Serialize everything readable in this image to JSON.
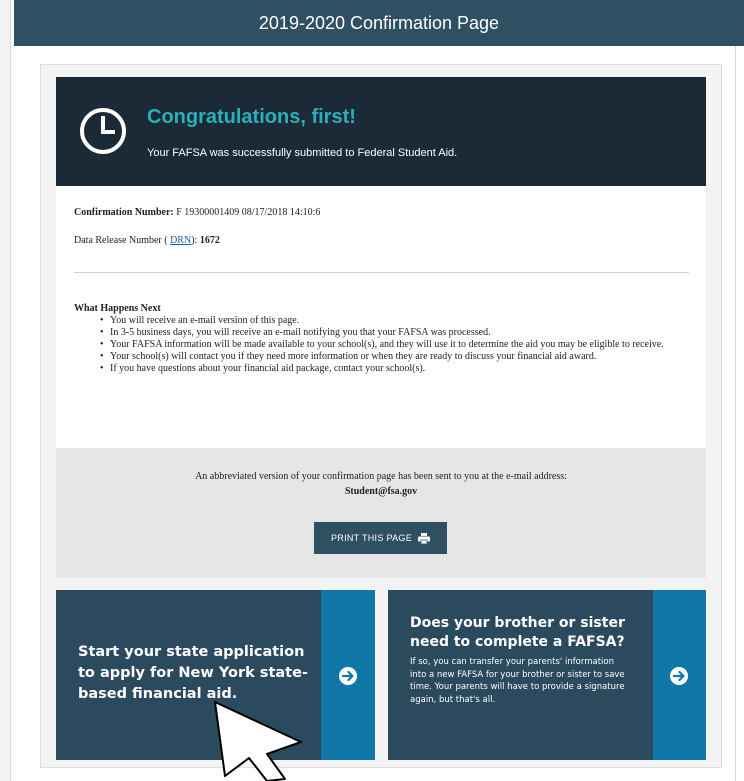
{
  "header": {
    "title": "2019-2020 Confirmation Page"
  },
  "hero": {
    "icon": "clock-icon",
    "title": "Congratulations, first!",
    "subtitle": "Your FAFSA was successfully submitted to Federal Student Aid."
  },
  "details": {
    "confirmation_label": "Confirmation Number:",
    "confirmation_value": "F 19300001409 08/17/2018 14:10:6",
    "drn_prefix": "Data Release Number (",
    "drn_link": "DRN",
    "drn_suffix": "):",
    "drn_value": "1672"
  },
  "next_steps": {
    "title": "What Happens Next",
    "items": [
      "You will receive an e-mail version of this page.",
      "In 3-5 business days, you will receive an e-mail notifying you that your FAFSA was processed.",
      "Your FAFSA information will be made available to your school(s), and they will use it to determine the aid you may be eligible to receive.",
      "Your school(s) will contact you if they need more information or when they are ready to discuss your financial aid award.",
      "If you have questions about your financial aid package, contact your school(s)."
    ]
  },
  "email_notice": {
    "text": "An abbreviated version of your confirmation page has been sent to you at the e-mail address:",
    "address": "Student@fsa.gov"
  },
  "print_button": {
    "label": "PRINT THIS PAGE",
    "icon": "printer-icon"
  },
  "cards": {
    "state": {
      "title": "Start your state application to apply for New York state-based financial aid.",
      "icon": "arrow-right-circle-icon"
    },
    "sibling": {
      "title": "Does your brother or sister need to complete a FAFSA?",
      "body": "If so, you can transfer your parents' information into a new FAFSA for your brother or sister to save time. Your parents will have to provide a signature again, but that's all.",
      "icon": "arrow-right-circle-icon"
    }
  },
  "colors": {
    "topbar": "#2f4f63",
    "hero_bg": "#1b2a36",
    "accent_teal": "#2ab0b7",
    "card_bg": "#2c4a5d",
    "card_action": "#0f78a8"
  }
}
